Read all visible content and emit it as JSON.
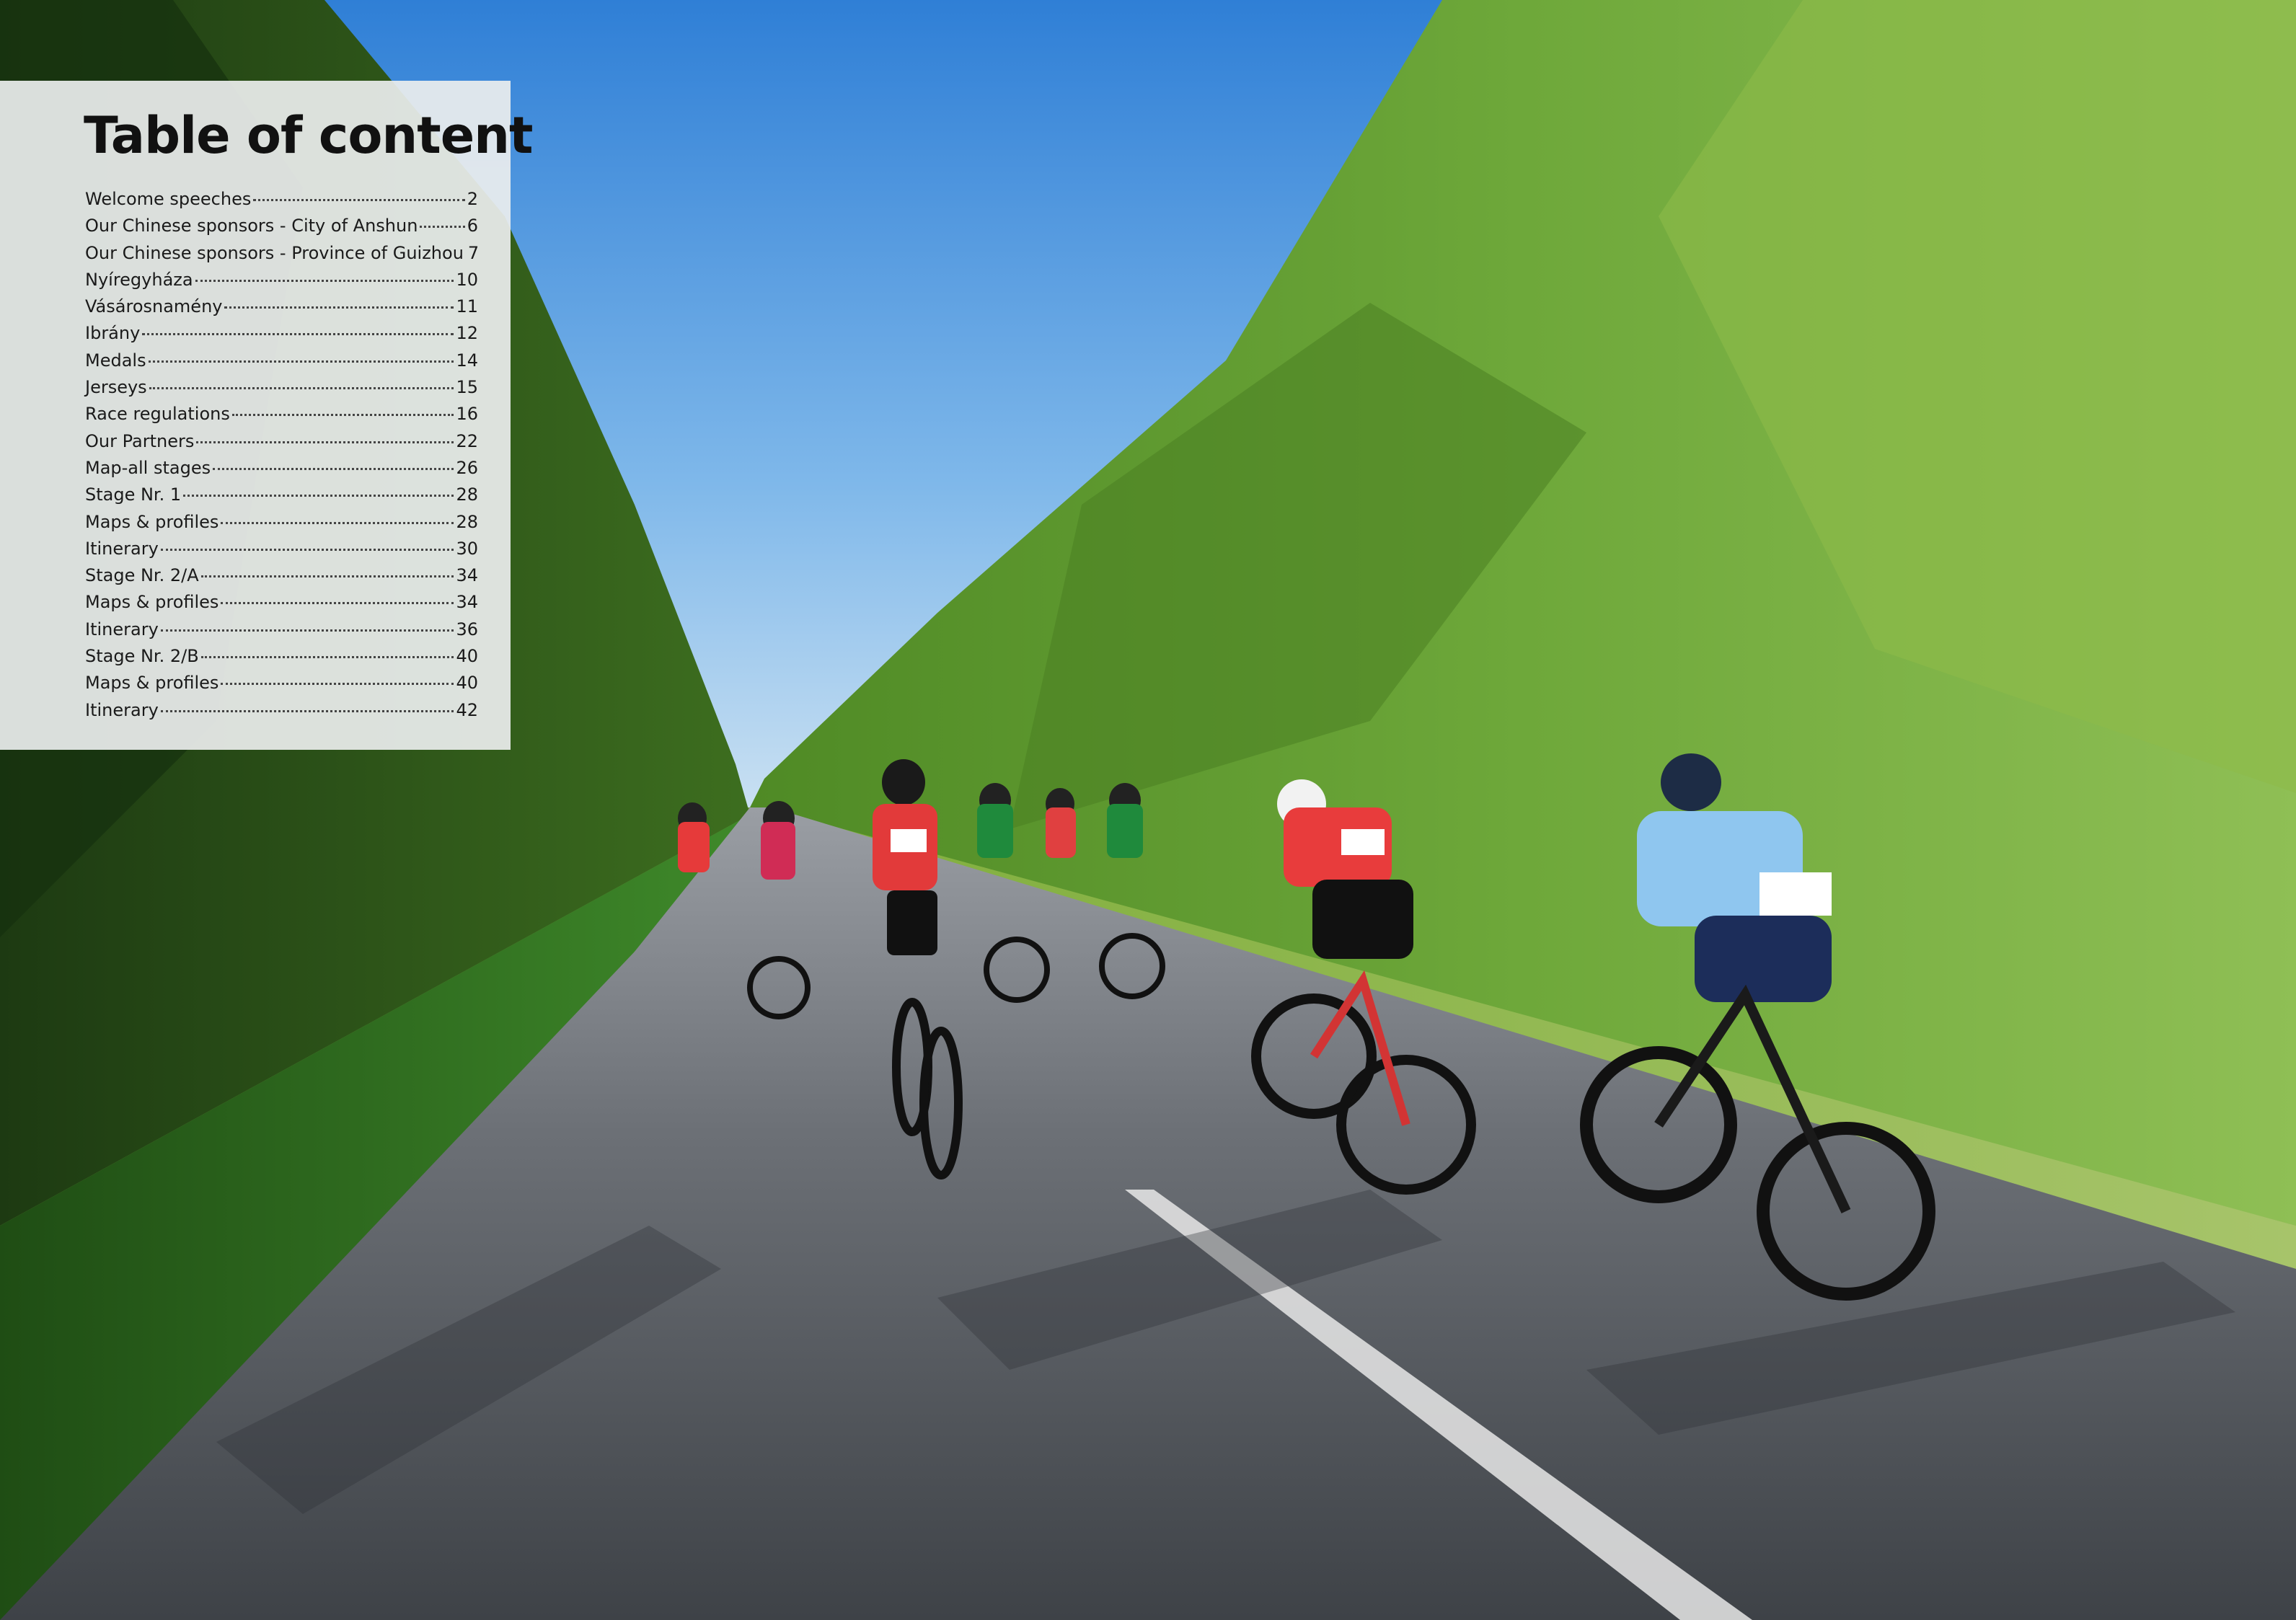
{
  "toc": {
    "title": "Table of content",
    "items": [
      {
        "label": "Welcome speeches",
        "page": "2"
      },
      {
        "label": "Our Chinese sponsors - City of Anshun",
        "page": "6"
      },
      {
        "label": "Our Chinese sponsors - Province of Guizhou",
        "page": "7"
      },
      {
        "label": "Nyíregyháza",
        "page": "10"
      },
      {
        "label": "Vásárosnamény",
        "page": "11"
      },
      {
        "label": "Ibrány",
        "page": "12"
      },
      {
        "label": "Medals",
        "page": "14"
      },
      {
        "label": "Jerseys",
        "page": "15"
      },
      {
        "label": "Race regulations",
        "page": "16"
      },
      {
        "label": "Our Partners",
        "page": "22"
      },
      {
        "label": "Map-all stages",
        "page": "26"
      },
      {
        "label": "Stage Nr. 1",
        "page": "28"
      },
      {
        "label": "Maps & profiles",
        "page": "28"
      },
      {
        "label": "Itinerary",
        "page": "30"
      },
      {
        "label": "Stage Nr. 2/A",
        "page": "34"
      },
      {
        "label": "Maps & profiles",
        "page": "34"
      },
      {
        "label": "Itinerary",
        "page": "36"
      },
      {
        "label": "Stage Nr. 2/B",
        "page": "40"
      },
      {
        "label": "Maps & profiles",
        "page": "40"
      },
      {
        "label": "Itinerary",
        "page": "42"
      }
    ]
  },
  "colors": {
    "sky": "#3f8fdc",
    "foliage": "#5f9a2e",
    "road": "#6d7075",
    "panel": "#eceeee"
  }
}
